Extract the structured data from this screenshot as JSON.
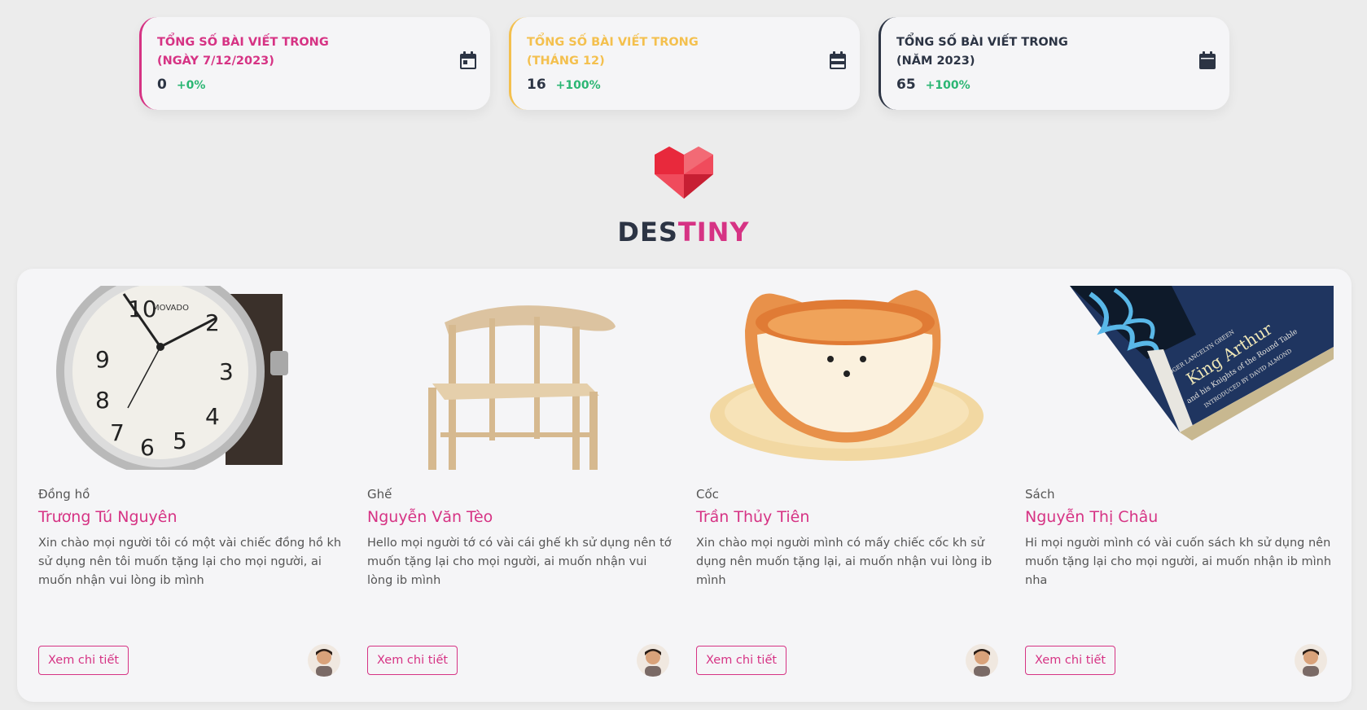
{
  "stats": [
    {
      "title_line1": "TỔNG SỐ BÀI VIẾT TRONG",
      "title_line2": "(NGÀY 7/12/2023)",
      "value": "0",
      "change": "+0%",
      "accent": "#d63384",
      "icon": "calendar-day-icon"
    },
    {
      "title_line1": "TỔNG SỐ BÀI VIẾT TRONG",
      "title_line2": "(THÁNG 12)",
      "value": "16",
      "change": "+100%",
      "accent": "#f4c04e",
      "icon": "calendar-month-icon"
    },
    {
      "title_line1": "TỔNG SỐ BÀI VIẾT TRONG",
      "title_line2": "(NĂM 2023)",
      "value": "65",
      "change": "+100%",
      "accent": "#2c3444",
      "icon": "calendar-year-icon"
    }
  ],
  "brand": {
    "part1": "DES",
    "part2": "TINY",
    "color1": "#2c3444",
    "color2": "#d63384",
    "logo": "heart-logo"
  },
  "cards": [
    {
      "category": "Đồng hồ",
      "name": "Trương Tú Nguyên",
      "description": "Xin chào mọi người tôi có một vài chiếc đồng hồ kh sử dụng nên tôi muốn tặng lại cho mọi người, ai muốn nhận vui lòng ib mình",
      "button": "Xem chi tiết",
      "image": "watch-image"
    },
    {
      "category": "Ghế",
      "name": "Nguyễn Văn Tèo",
      "description": "Hello mọi người tớ có vài cái ghế kh sử dụng nên tớ muốn tặng lại cho mọi người, ai muốn nhận vui lòng ib mình",
      "button": "Xem chi tiết",
      "image": "chair-image"
    },
    {
      "category": "Cốc",
      "name": "Trần Thủy Tiên",
      "description": "Xin chào mọi người mình có mấy chiếc cốc kh sử dụng nên muốn tặng lại, ai muốn nhận vui lòng ib mình",
      "button": "Xem chi tiết",
      "image": "cup-image"
    },
    {
      "category": "Sách",
      "name": "Nguyễn Thị Châu",
      "description": "Hi mọi người mình có vài cuốn sách kh sử dụng nên muốn tặng lại cho mọi người, ai muốn nhận ib mình nha",
      "button": "Xem chi tiết",
      "image": "book-image",
      "book_title": "King Arthur",
      "book_subtitle": "and his Knights of the Round Table",
      "book_author": "ROGER LANCELYN GREEN",
      "book_intro": "INTRODUCED BY DAVID ALMOND"
    }
  ],
  "colors": {
    "accent": "#d63384",
    "positive": "#2bb673",
    "dark": "#2c3444",
    "yellow": "#f4c04e"
  }
}
